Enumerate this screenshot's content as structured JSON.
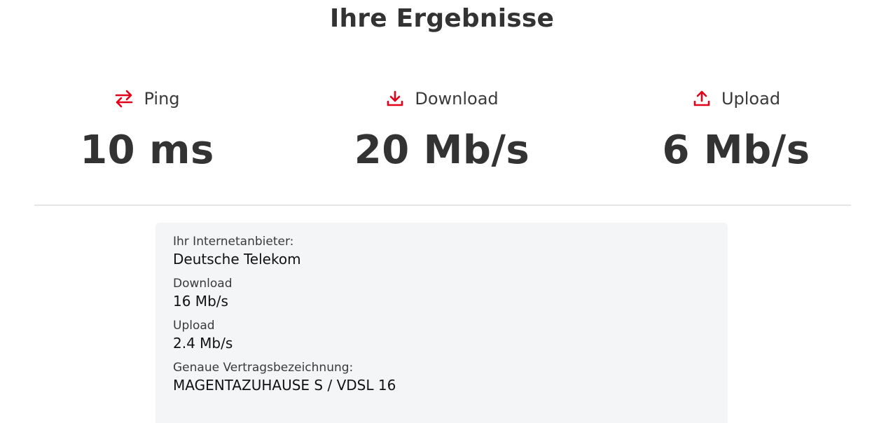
{
  "page": {
    "title": "Ihre Ergebnisse"
  },
  "metrics": {
    "ping": {
      "label": "Ping",
      "value": "10 ms",
      "icon": "swap-arrows-icon"
    },
    "download": {
      "label": "Download",
      "value": "20 Mb/s",
      "icon": "download-icon"
    },
    "upload": {
      "label": "Upload",
      "value": "6 Mb/s",
      "icon": "upload-icon"
    }
  },
  "info": {
    "provider_label": "Ihr Internetanbieter:",
    "provider_value": "Deutsche Telekom",
    "download_label": "Download",
    "download_value": "16 Mb/s",
    "upload_label": "Upload",
    "upload_value": "2.4 Mb/s",
    "contract_label": "Genaue Vertragsbezeichnung:",
    "contract_value": "MAGENTAZUHAUSE S / VDSL 16"
  },
  "colors": {
    "accent": "#e2001a",
    "text": "#333333",
    "panel": "#f4f5f7"
  }
}
